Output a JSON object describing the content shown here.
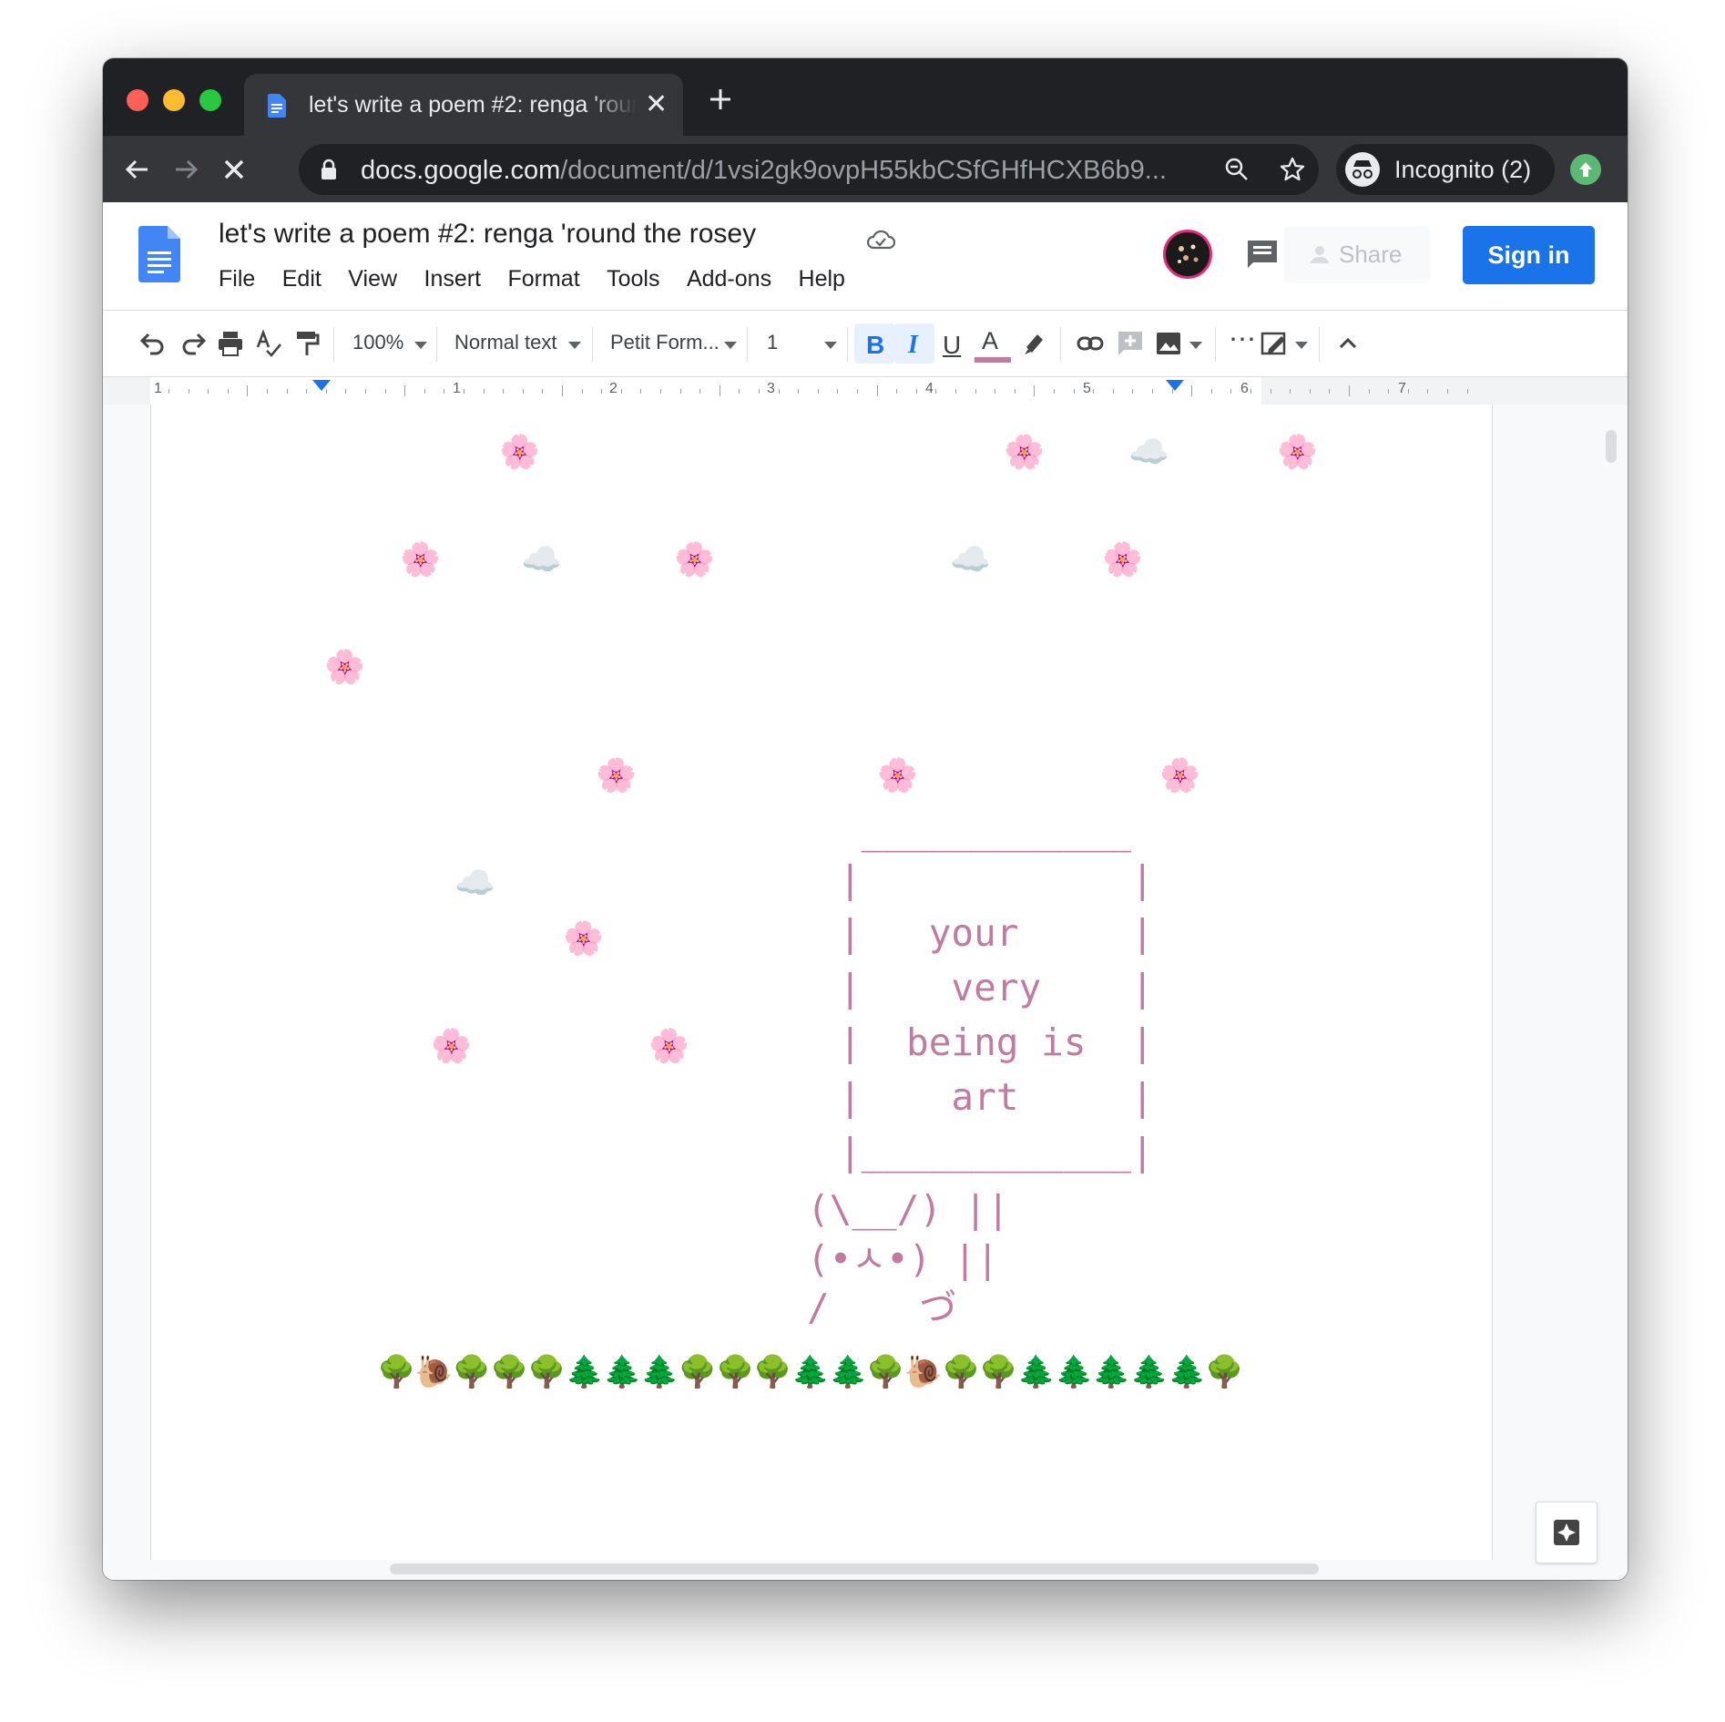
{
  "browser": {
    "tab_title": "let's write a poem #2: renga 'round the rosey",
    "tab_close": "✕",
    "url_host": "docs.google.com",
    "url_path": "/document/d/1vsi2gk9ovpH55kbCSfGHfHCXB6b9...",
    "profile_label": "Incognito (2)"
  },
  "docs": {
    "title": "let's write a poem #2: renga 'round the rosey",
    "menu": [
      "File",
      "Edit",
      "View",
      "Insert",
      "Format",
      "Tools",
      "Add-ons",
      "Help"
    ],
    "share_label": "Share",
    "signin_label": "Sign in"
  },
  "format_toolbar": {
    "zoom": "100%",
    "style": "Normal text",
    "font": "Petit Form...",
    "font_size": "1",
    "bold": "B",
    "italic": "I",
    "underline": "U",
    "text_color_glyph": "A",
    "text_color": "#c27ba0",
    "more": "⋯"
  },
  "ruler": {
    "labels": [
      "1",
      "1",
      "2",
      "3",
      "4",
      "5",
      "6",
      "7"
    ]
  },
  "document": {
    "emoji_scatter": {
      "flower": "🌸",
      "cloud": "☁️"
    },
    "sign_art": [
      " ____________",
      "|            |",
      "|   your     |",
      "|    very    |",
      "|  being is  |",
      "|    art     |",
      "|____________|"
    ],
    "bunny_art": [
      "(\\__/) ||",
      "(•ㅅ•) ||",
      "/    づ"
    ],
    "ground_row": "🌳🐌🌳🌳🌳🌲🌲🌲🌳🌳🌳🌲🌲🌳🐌🌳🌳🌲🌲🌲🌲🌲🌳"
  }
}
